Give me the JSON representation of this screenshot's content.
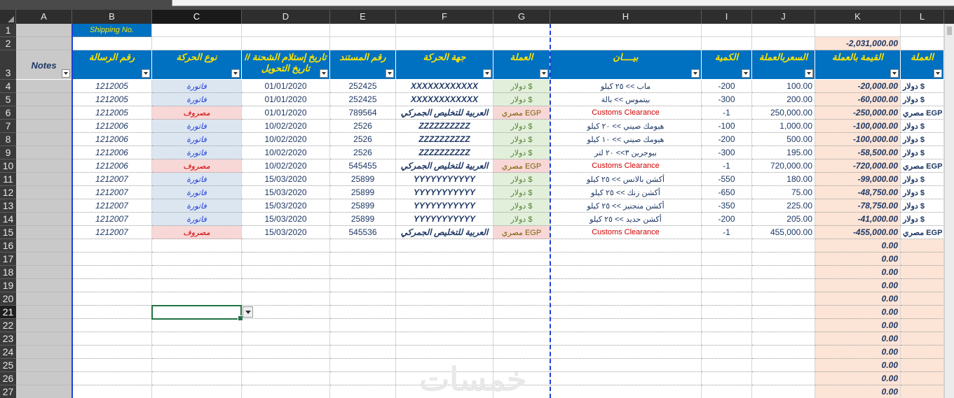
{
  "columns": [
    "A",
    "B",
    "C",
    "D",
    "E",
    "F",
    "G",
    "H",
    "I",
    "J",
    "K",
    "L"
  ],
  "selected_column": "C",
  "selected_row": "21",
  "row_numbers": [
    "1",
    "2",
    "3",
    "4",
    "5",
    "6",
    "7",
    "8",
    "9",
    "10",
    "11",
    "12",
    "13",
    "14",
    "15",
    "16",
    "17",
    "18",
    "19",
    "20",
    "21",
    "22",
    "23",
    "24",
    "25",
    "26",
    "27"
  ],
  "shipping_label": "Shipping No.",
  "total_value": "-2,031,000.00",
  "headers": {
    "A": "Notes",
    "B": "رقم الرسالة",
    "C": "نوع الحركة",
    "D": "تاريخ إستلام الشحنة //تاريخ التحويل",
    "E": "رقم المستند",
    "F": "جهة الحركة",
    "G": "العملة",
    "H": "بيــــان",
    "I": "الكمية",
    "J": "السعربالعملة",
    "K": "القيمة بالعملة",
    "L": "العملة"
  },
  "rows": [
    {
      "B": "1212005",
      "C": "فاتورة",
      "D": "01/01/2020",
      "E": "252425",
      "F": "XXXXXXXXXXXX",
      "G": "دولار $",
      "H": "ماب >> ٢٥ كيلو",
      "I": "-200",
      "J": "100.00",
      "K": "-20,000.00",
      "L": "دولار $",
      "type": "invoice"
    },
    {
      "B": "1212005",
      "C": "فاتورة",
      "D": "01/01/2020",
      "E": "252425",
      "F": "XXXXXXXXXXXX",
      "G": "دولار $",
      "H": "بيتموس >> بالة",
      "I": "-300",
      "J": "200.00",
      "K": "-60,000.00",
      "L": "دولار $",
      "type": "invoice"
    },
    {
      "B": "1212005",
      "C": "مصروف",
      "D": "01/01/2020",
      "E": "789564",
      "F": "العربية للتخليص الجمركي",
      "G": "مصري EGP",
      "H": "Customs Clearance",
      "I": "-1",
      "J": "250,000.00",
      "K": "-250,000.00",
      "L": "مصري EGP",
      "type": "expense"
    },
    {
      "B": "1212006",
      "C": "فاتورة",
      "D": "10/02/2020",
      "E": "2526",
      "F": "ZZZZZZZZZZ",
      "G": "دولار $",
      "H": "هيومك صيني >> ٢٠ كيلو",
      "I": "-100",
      "J": "1,000.00",
      "K": "-100,000.00",
      "L": "دولار $",
      "type": "invoice"
    },
    {
      "B": "1212006",
      "C": "فاتورة",
      "D": "10/02/2020",
      "E": "2526",
      "F": "ZZZZZZZZZZ",
      "G": "دولار $",
      "H": "هيومك صيني >> ١٠ كيلو",
      "I": "-200",
      "J": "500.00",
      "K": "-100,000.00",
      "L": "دولار $",
      "type": "invoice"
    },
    {
      "B": "1212006",
      "C": "فاتورة",
      "D": "10/02/2020",
      "E": "2526",
      "F": "ZZZZZZZZZZ",
      "G": "دولار $",
      "H": "بيوجرين ٣>> ٢٠ لتر",
      "I": "-300",
      "J": "195.00",
      "K": "-58,500.00",
      "L": "دولار $",
      "type": "invoice"
    },
    {
      "B": "1212006",
      "C": "مصروف",
      "D": "10/02/2020",
      "E": "545455",
      "F": "العربية للتخليص الجمركي",
      "G": "مصري EGP",
      "H": "Customs Clearance",
      "I": "-1",
      "J": "720,000.00",
      "K": "-720,000.00",
      "L": "مصري EGP",
      "type": "expense"
    },
    {
      "B": "1212007",
      "C": "فاتورة",
      "D": "15/03/2020",
      "E": "25899",
      "F": "YYYYYYYYYYY",
      "G": "دولار $",
      "H": "أكشن بالانس >> ٢٥ كيلو",
      "I": "-550",
      "J": "180.00",
      "K": "-99,000.00",
      "L": "دولار $",
      "type": "invoice"
    },
    {
      "B": "1212007",
      "C": "فاتورة",
      "D": "15/03/2020",
      "E": "25899",
      "F": "YYYYYYYYYYY",
      "G": "دولار $",
      "H": "أكشن زنك >> ٢٥ كيلو",
      "I": "-650",
      "J": "75.00",
      "K": "-48,750.00",
      "L": "دولار $",
      "type": "invoice"
    },
    {
      "B": "1212007",
      "C": "فاتورة",
      "D": "15/03/2020",
      "E": "25899",
      "F": "YYYYYYYYYYY",
      "G": "دولار $",
      "H": "أكشن منجنيز >> ٢٥ كيلو",
      "I": "-350",
      "J": "225.00",
      "K": "-78,750.00",
      "L": "دولار $",
      "type": "invoice"
    },
    {
      "B": "1212007",
      "C": "فاتورة",
      "D": "15/03/2020",
      "E": "25899",
      "F": "YYYYYYYYYYY",
      "G": "دولار $",
      "H": "أكشن حديد >> ٢٥ كيلو",
      "I": "-200",
      "J": "205.00",
      "K": "-41,000.00",
      "L": "دولار $",
      "type": "invoice"
    },
    {
      "B": "1212007",
      "C": "مصروف",
      "D": "15/03/2020",
      "E": "545536",
      "F": "العربية للتخليص الجمركي",
      "G": "مصري EGP",
      "H": "Customs Clearance",
      "I": "-1",
      "J": "455,000.00",
      "K": "-455,000.00",
      "L": "مصري EGP",
      "type": "expense"
    }
  ],
  "empty_k_value": "0.00",
  "watermark": "خمسات",
  "colors": {
    "header_blue": "#0070c0",
    "header_text": "#ffe600",
    "invoice_bg": "#dce6f1",
    "expense_bg": "#f8d7d7",
    "currency_bg": "#e2efda",
    "value_bg": "#fce4d6"
  }
}
